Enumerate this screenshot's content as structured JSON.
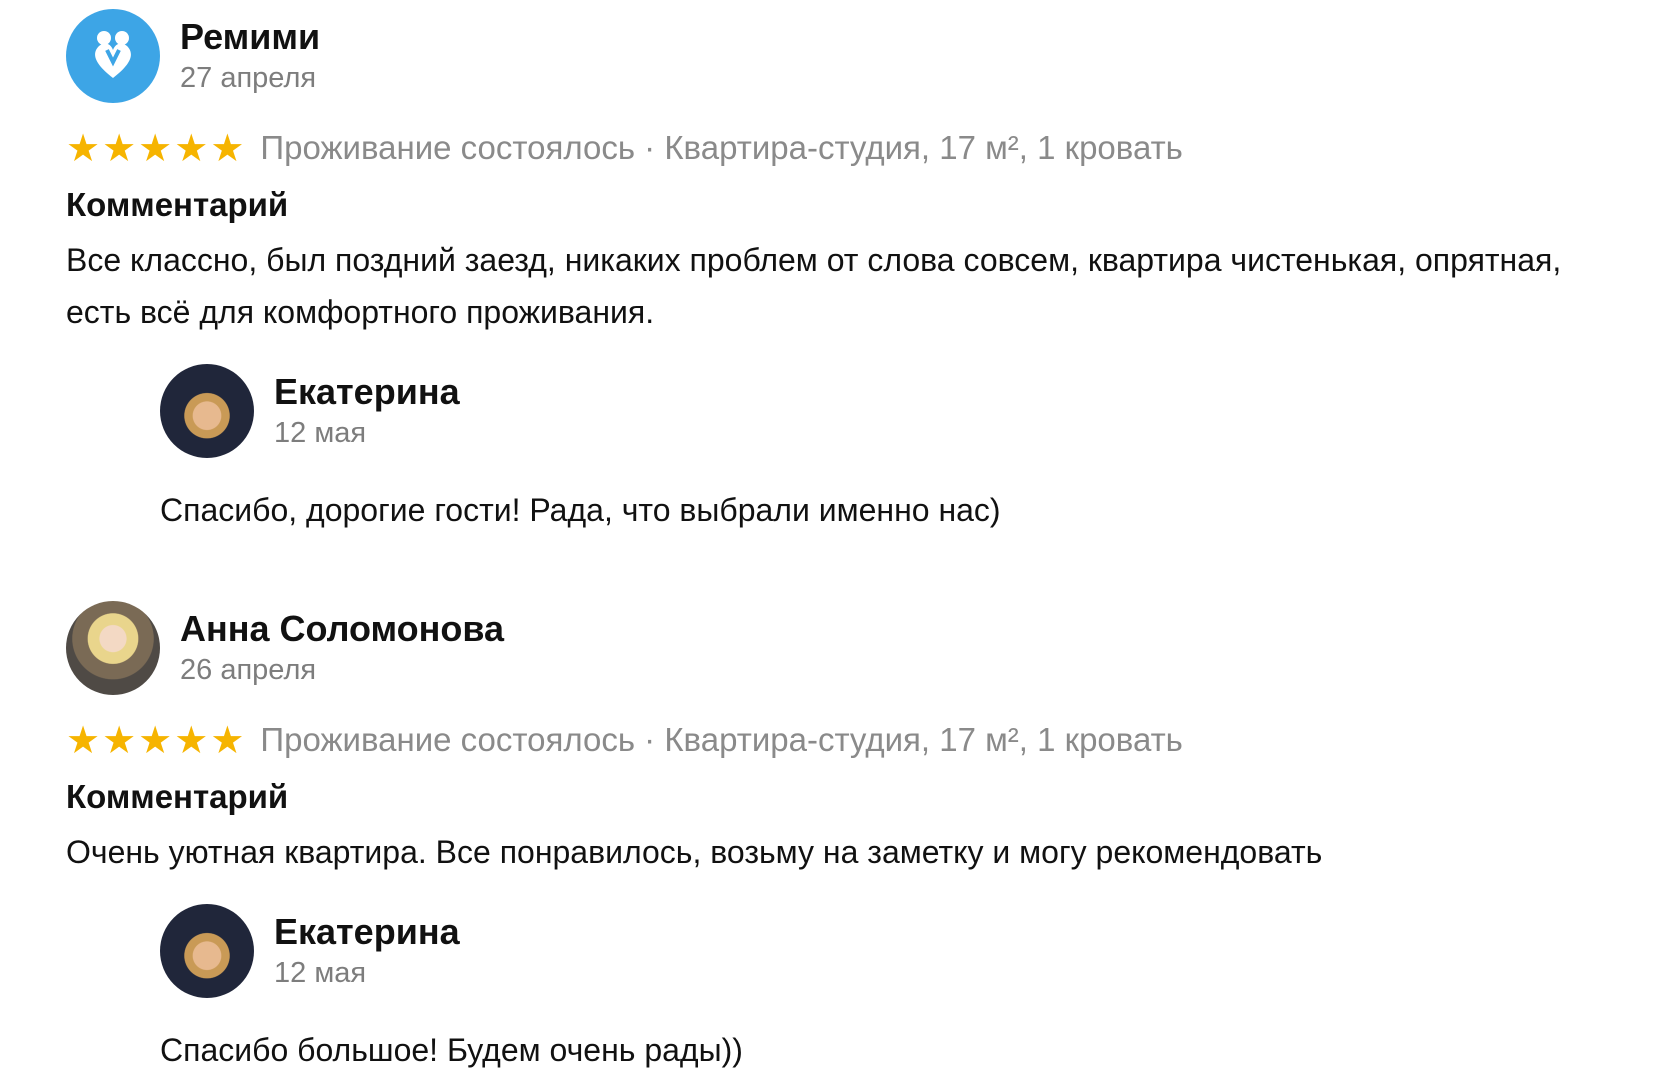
{
  "reviews": [
    {
      "author": "Ремими",
      "avatar_icon": "hearts-logo-icon",
      "date": "27 апреля",
      "rating": 5,
      "stars": [
        "★",
        "★",
        "★",
        "★",
        "★"
      ],
      "stay_info": "Проживание состоялось · Квартира-студия, 17 м², 1 кровать",
      "comment_label": "Комментарий",
      "comment": "Все классно, был поздний заезд, никаких проблем от слова совсем, квартира чистенькая, опрятная, есть всё для комфортного проживания.",
      "reply": {
        "author": "Екатерина",
        "date": "12 мая",
        "text": "Спасибо, дорогие гости! Рада, что выбрали именно нас)"
      }
    },
    {
      "author": "Анна Соломонова",
      "date": "26 апреля",
      "rating": 5,
      "stars": [
        "★",
        "★",
        "★",
        "★",
        "★"
      ],
      "stay_info": "Проживание состоялось · Квартира-студия, 17 м², 1 кровать",
      "comment_label": "Комментарий",
      "comment": "Очень уютная квартира. Все понравилось, возьму на заметку и могу рекомендовать",
      "reply": {
        "author": "Екатерина",
        "date": "12 мая",
        "text": "Спасибо большое! Будем очень рады))"
      }
    }
  ],
  "colors": {
    "star": "#f6b400",
    "brand_avatar": "#3da5e6",
    "muted_text": "#8a8a8a"
  }
}
